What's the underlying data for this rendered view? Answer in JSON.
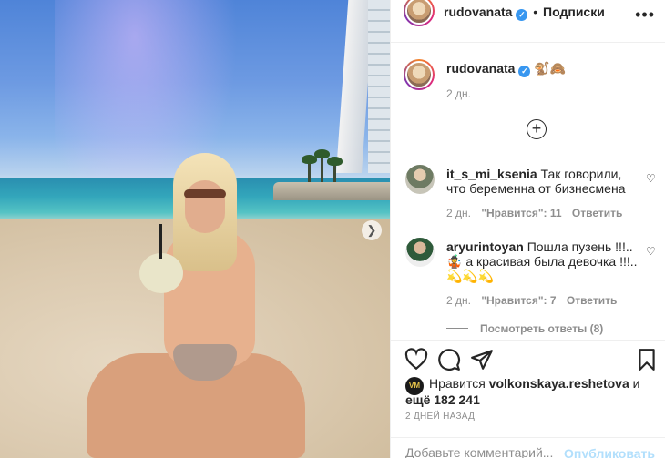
{
  "post": {
    "author": "rudovanata",
    "follow_separator": "•",
    "follow_label": "Подписки",
    "more_label": "•••",
    "caption_emoji": "🐒🙈",
    "caption_time": "2 дн."
  },
  "comments": [
    {
      "username": "it_s_mi_ksenia",
      "text": "Так говорили, что беременна от бизнесмена",
      "time": "2 дн.",
      "likes": "\"Нравится\": 11",
      "reply": "Ответить"
    },
    {
      "username": "aryurintoyan",
      "text_line1": "Пошла пузень !!!.. ",
      "text_line2": "🤹 а красивая была девочка !!!.. ",
      "text_line3": "💫💫💫",
      "time": "2 дн.",
      "likes": "\"Нравится\": 7",
      "reply": "Ответить",
      "view_replies": "Посмотреть ответы (8)"
    }
  ],
  "actions": {
    "likes_prefix": "Нравится ",
    "liker_name": "volkonskaya.reshetova",
    "likes_middle": " и",
    "likes_suffix": "ещё 182 241",
    "liker_badge": "VM",
    "date": "2 ДНЕЙ НАЗАД",
    "comment_placeholder": "Добавьте комментарий...",
    "publish_label": "Опубликовать"
  },
  "icons": {
    "verified": "verified-badge-icon",
    "like": "heart-icon",
    "comment": "comment-icon",
    "share": "share-icon",
    "save": "bookmark-icon",
    "add": "plus-circle-icon",
    "next": "chevron-right-icon"
  },
  "colors": {
    "verified_blue": "#3897f0",
    "publish_disabled": "#b2dffc",
    "muted_text": "#8e8e8e"
  }
}
